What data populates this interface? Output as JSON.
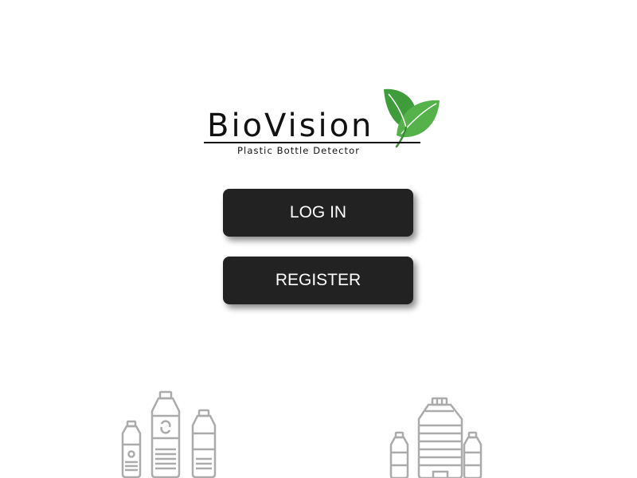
{
  "logo": {
    "title": "BioVision",
    "tagline": "Plastic Bottle Detector",
    "icon": "leaf-icon",
    "accent_color": "#3aa843"
  },
  "buttons": {
    "login_label": "LOG IN",
    "register_label": "REGISTER",
    "background_color": "#222222",
    "text_color": "#ffffff"
  },
  "illustrations": {
    "left": "plastic-bottles-icon",
    "right": "water-jug-bottles-icon",
    "stroke_color": "#8f8f8f"
  }
}
